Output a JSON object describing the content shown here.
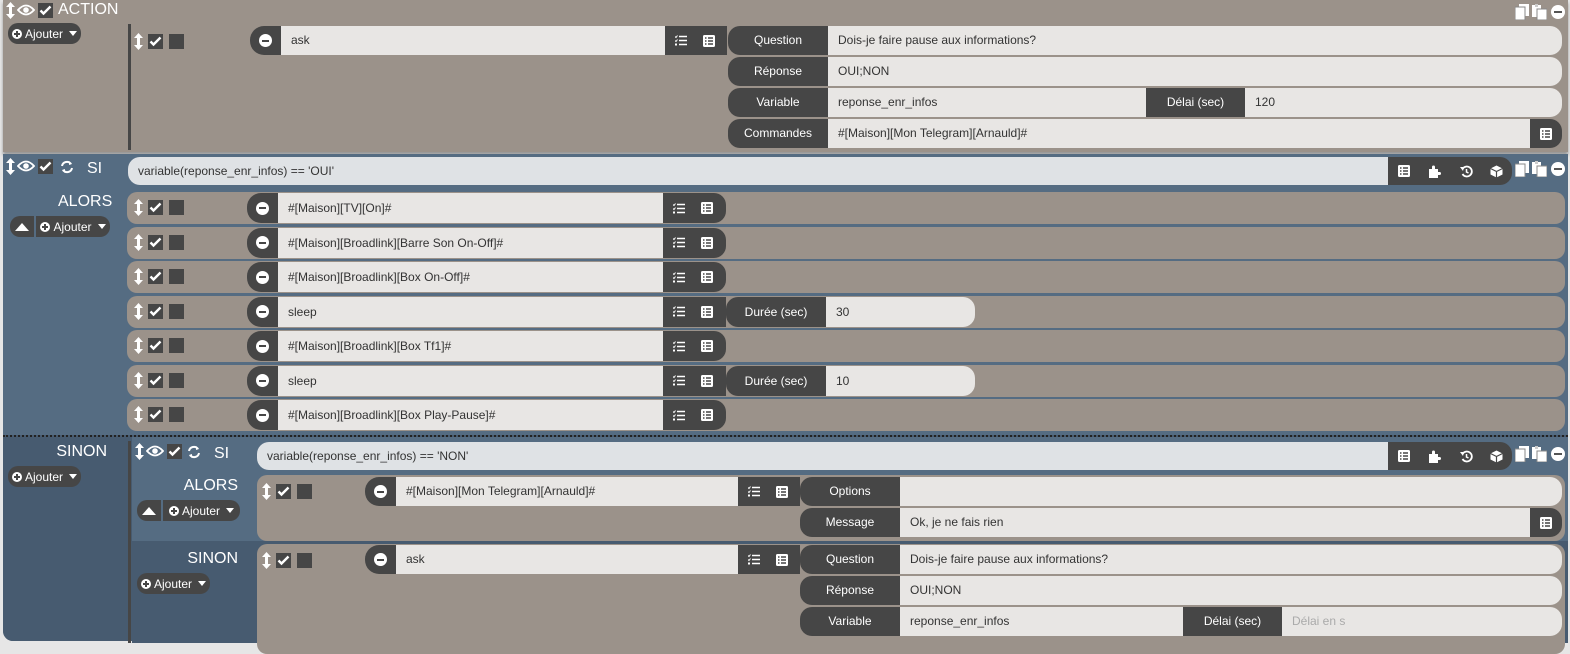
{
  "colors": {
    "tan": "#9b928a",
    "blue": "#556c82",
    "blue_dark": "#475b70",
    "dark": "#464646",
    "input": "#e8e6e4"
  },
  "action": {
    "title": "ACTION",
    "add_label": "Ajouter",
    "cmd": {
      "name": "ask",
      "question_label": "Question",
      "question": "Dois-je faire pause aux informations?",
      "reponse_label": "Réponse",
      "reponse": "OUI;NON",
      "variable_label": "Variable",
      "variable": "reponse_enr_infos",
      "delai_label": "Délai (sec)",
      "delai": "120",
      "commandes_label": "Commandes",
      "commandes": "#[Maison][Mon Telegram][Arnauld]#"
    }
  },
  "si": {
    "label": "SI",
    "condition": "variable(reponse_enr_infos) == 'OUI'",
    "alors_label": "ALORS",
    "add_label": "Ajouter",
    "alors": [
      {
        "name": "#[Maison][TV][On]#"
      },
      {
        "name": "#[Maison][Broadlink][Barre Son On-Off]#"
      },
      {
        "name": "#[Maison][Broadlink][Box On-Off]#"
      },
      {
        "name": "sleep",
        "duree_label": "Durée (sec)",
        "duree": "30"
      },
      {
        "name": "#[Maison][Broadlink][Box Tf1]#"
      },
      {
        "name": "sleep",
        "duree_label": "Durée (sec)",
        "duree": "10"
      },
      {
        "name": "#[Maison][Broadlink][Box Play-Pause]#"
      }
    ],
    "sinon_label": "SINON",
    "sinon_add_label": "Ajouter",
    "nested": {
      "label": "SI",
      "condition": "variable(reponse_enr_infos) == 'NON'",
      "alors_label": "ALORS",
      "add_label": "Ajouter",
      "alors_cmd": {
        "name": "#[Maison][Mon Telegram][Arnauld]#",
        "options_label": "Options",
        "options": "",
        "message_label": "Message",
        "message": "Ok, je ne fais rien"
      },
      "sinon_label": "SINON",
      "sinon_add_label": "Ajouter",
      "sinon_cmd": {
        "name": "ask",
        "question_label": "Question",
        "question": "Dois-je faire pause aux informations?",
        "reponse_label": "Réponse",
        "reponse": "OUI;NON",
        "variable_label": "Variable",
        "variable": "reponse_enr_infos",
        "delai_label": "Délai (sec)",
        "delai_placeholder": "Délai en s"
      }
    }
  }
}
